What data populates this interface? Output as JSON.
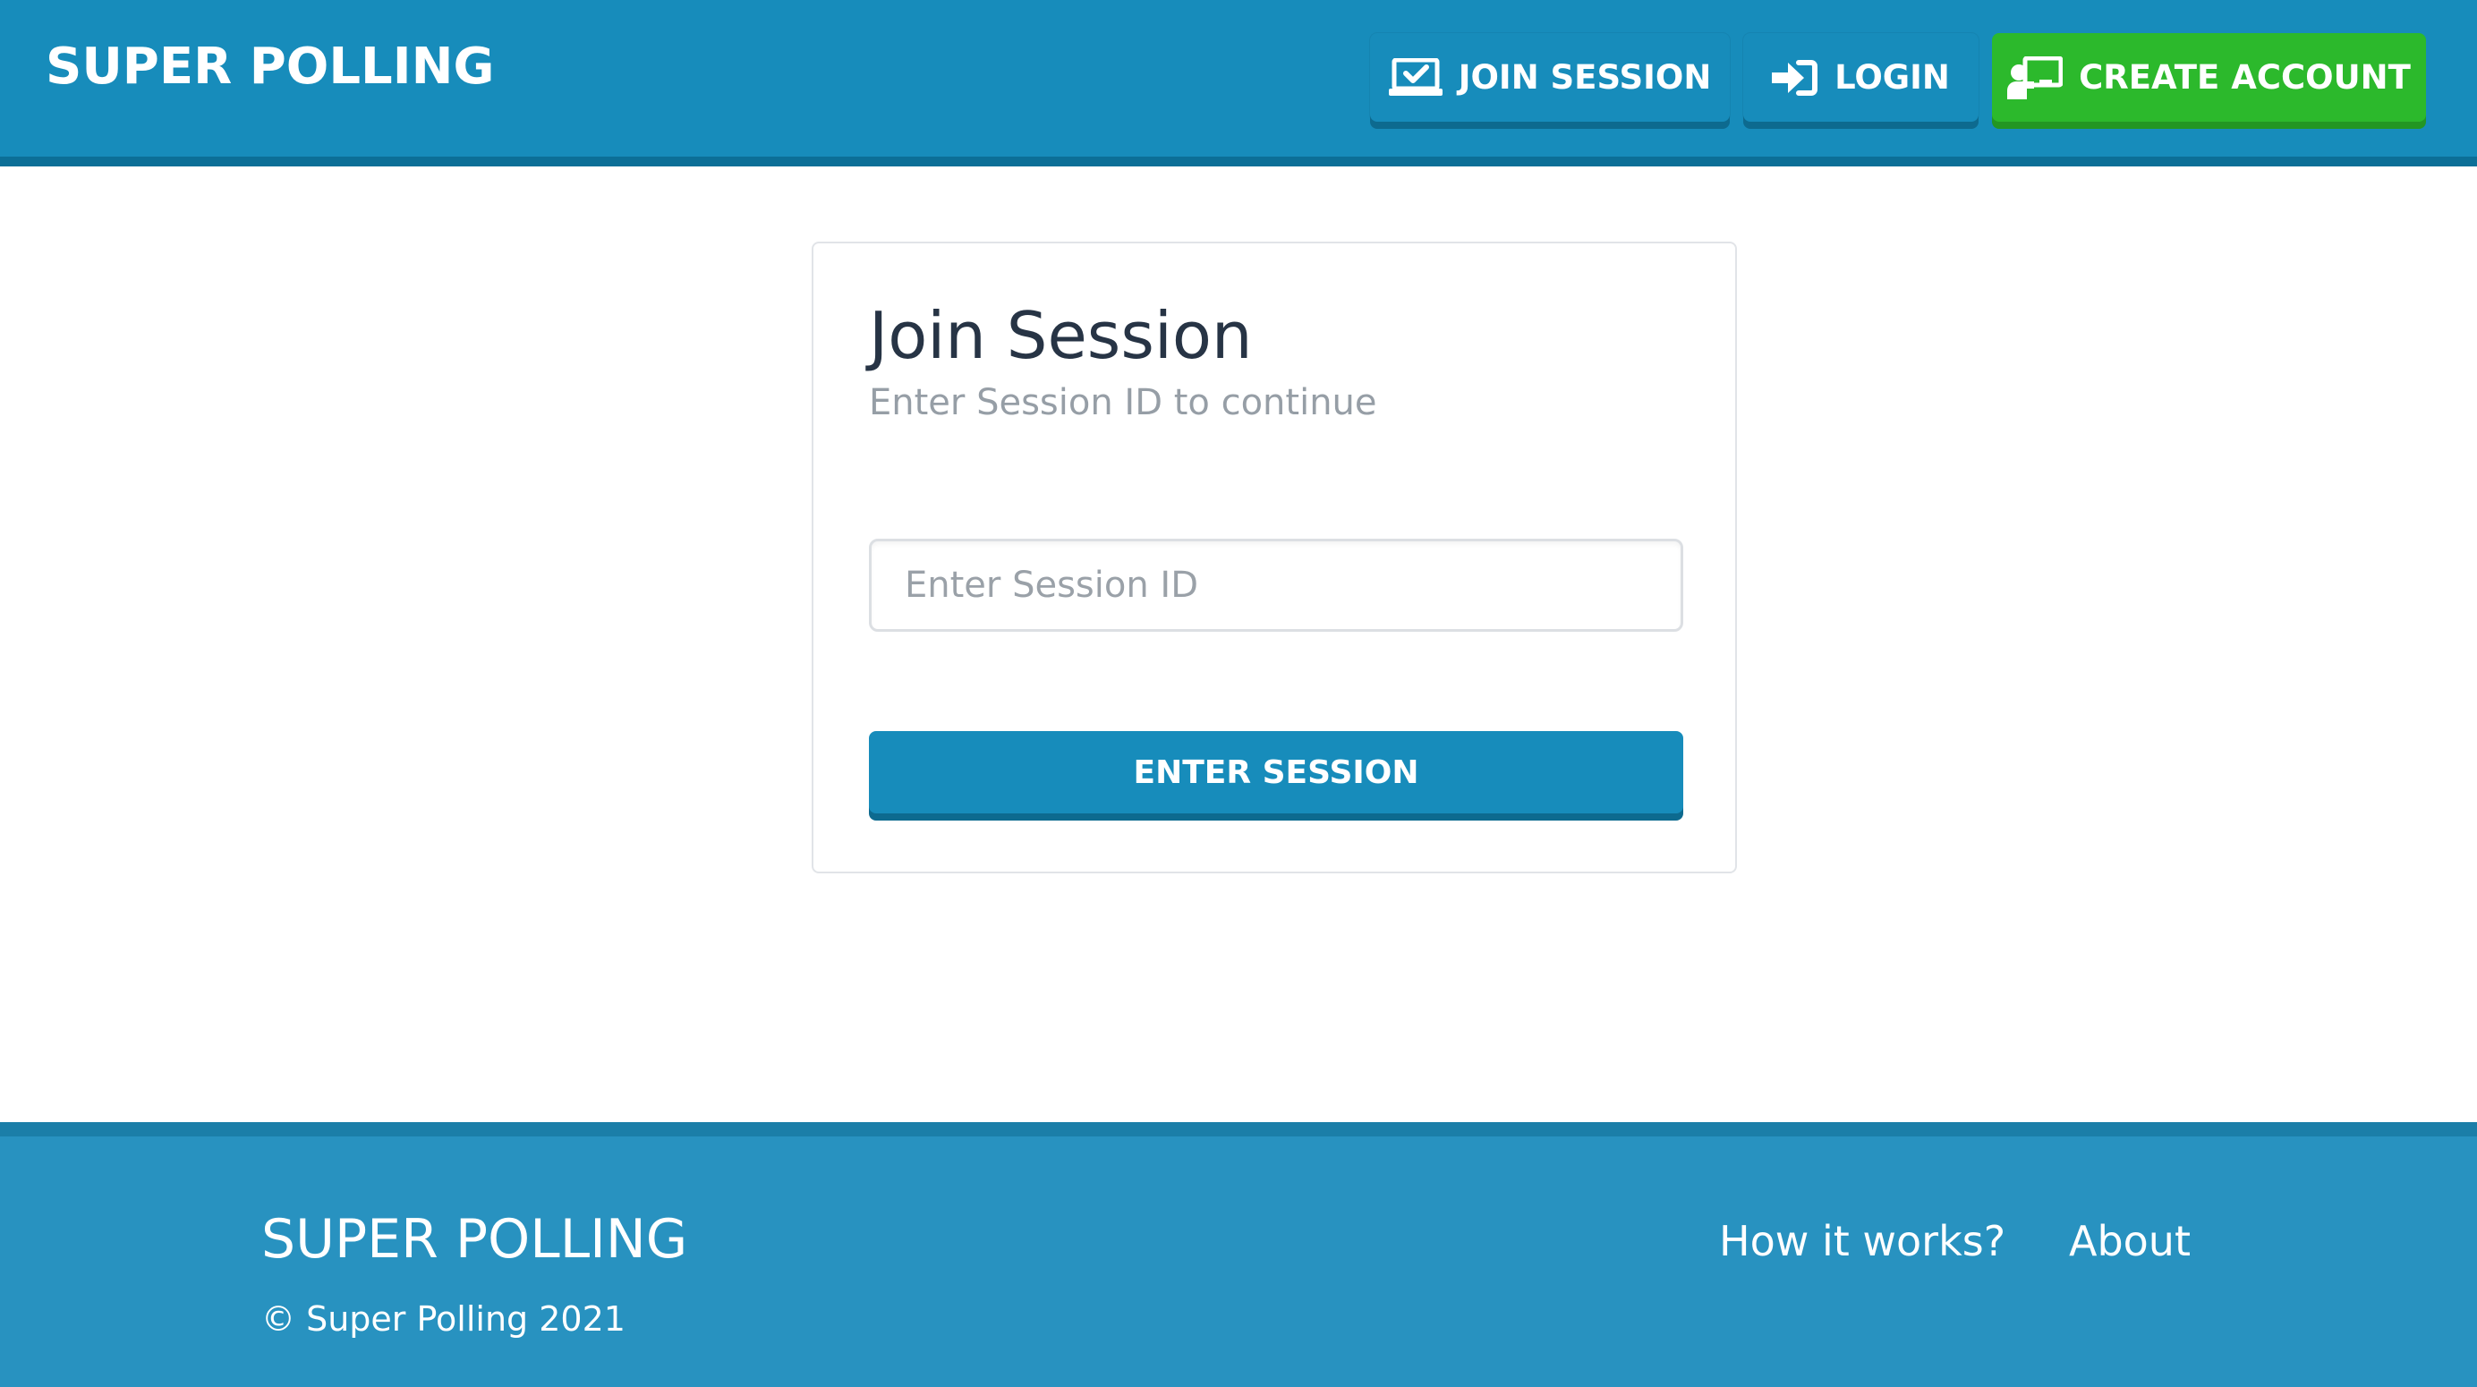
{
  "header": {
    "brand": "SUPER POLLING",
    "nav": {
      "join_session": {
        "label": "JOIN SESSION",
        "icon": "laptop-check-icon"
      },
      "login": {
        "label": "LOGIN",
        "icon": "sign-in-icon"
      },
      "create_account": {
        "label": "CREATE ACCOUNT",
        "icon": "chalkboard-teacher-icon"
      }
    }
  },
  "card": {
    "title": "Join Session",
    "subtitle": "Enter Session ID to continue",
    "session_input": {
      "placeholder": "Enter Session ID",
      "value": ""
    },
    "submit_label": "ENTER SESSION"
  },
  "footer": {
    "brand": "SUPER POLLING",
    "copyright": "© Super Polling 2021",
    "links": [
      {
        "label": "How it works?"
      },
      {
        "label": "About"
      }
    ]
  },
  "colors": {
    "primary": "#178cbb",
    "primary_dark": "#0d6a8f",
    "success": "#2cb92c",
    "footer_bg": "#2892c0",
    "title_text": "#273445",
    "muted_text": "#969ea6"
  }
}
